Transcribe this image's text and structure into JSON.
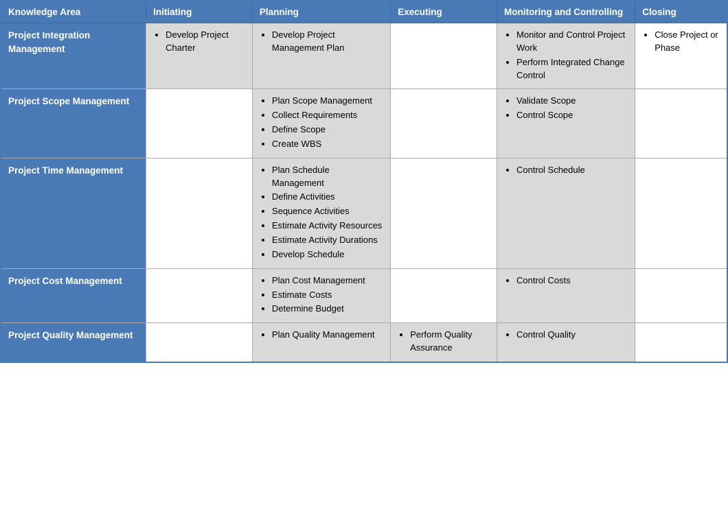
{
  "header": {
    "col1": "Knowledge Area",
    "col2": "Initiating",
    "col3": "Planning",
    "col4": "Executing",
    "col5": "Monitoring and Controlling",
    "col6": "Closing"
  },
  "rows": [
    {
      "knowledge_area": "Project Integration Management",
      "initiating": [
        "Develop Project Charter"
      ],
      "planning": [
        "Develop Project Management Plan"
      ],
      "executing": [],
      "monitoring": [
        "Monitor and Control Project Work",
        "Perform Integrated Change Control"
      ],
      "closing": [
        "Close Project or Phase"
      ],
      "initiating_white": false,
      "executing_white": true,
      "closing_white": false
    },
    {
      "knowledge_area": "Project Scope Management",
      "initiating": [],
      "planning": [
        "Plan Scope Management",
        "Collect Requirements",
        "Define Scope",
        "Create WBS"
      ],
      "executing": [],
      "monitoring": [
        "Validate Scope",
        "Control Scope"
      ],
      "closing": [],
      "initiating_white": true,
      "executing_white": true,
      "closing_white": true
    },
    {
      "knowledge_area": "Project Time Management",
      "initiating": [],
      "planning": [
        "Plan Schedule Management",
        "Define Activities",
        "Sequence Activities",
        "Estimate Activity Resources",
        "Estimate Activity Durations",
        "Develop Schedule"
      ],
      "executing": [],
      "monitoring": [
        "Control Schedule"
      ],
      "closing": [],
      "initiating_white": true,
      "executing_white": true,
      "closing_white": true
    },
    {
      "knowledge_area": "Project Cost Management",
      "initiating": [],
      "planning": [
        "Plan Cost Management",
        "Estimate Costs",
        "Determine Budget"
      ],
      "executing": [],
      "monitoring": [
        "Control Costs"
      ],
      "closing": [],
      "initiating_white": true,
      "executing_white": true,
      "closing_white": true
    },
    {
      "knowledge_area": "Project Quality Management",
      "initiating": [],
      "planning": [
        "Plan Quality Management"
      ],
      "executing": [
        "Perform Quality Assurance"
      ],
      "monitoring": [
        "Control Quality"
      ],
      "closing": [],
      "initiating_white": true,
      "executing_white": false,
      "closing_white": true
    }
  ]
}
